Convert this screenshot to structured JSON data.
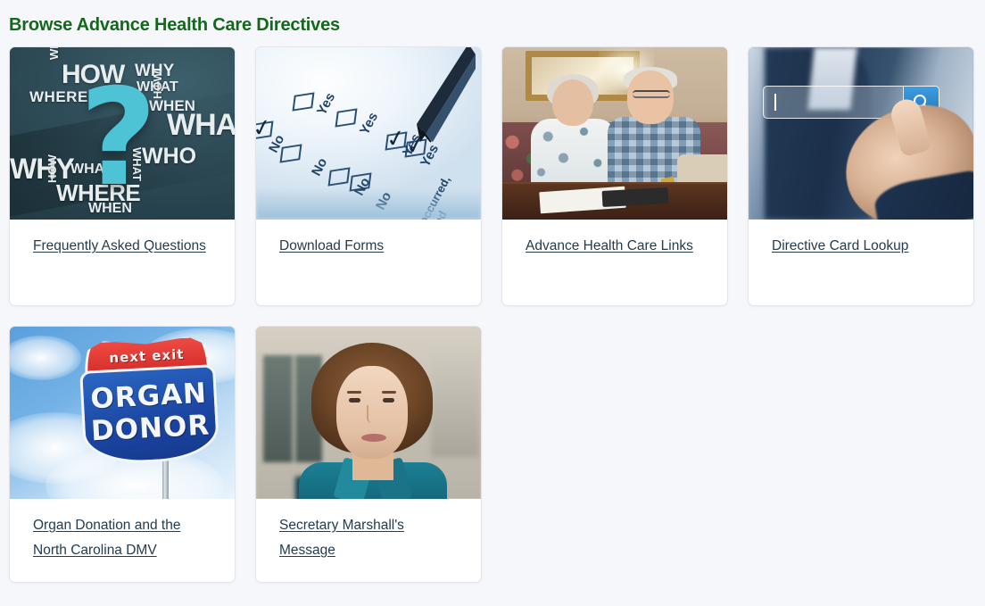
{
  "page": {
    "title": "Browse Advance Health Care Directives",
    "title_color": "#14681c",
    "background_color": "#f6f7fb",
    "link_color": "#243c4f",
    "card_background": "#ffffff",
    "card_border_color": "#e3e5ea"
  },
  "cards": [
    {
      "id": "faq",
      "link_label": "Frequently Asked Questions",
      "image_name": "question-mark-chalkboard-image",
      "image_alt": "Teal chalkboard covered with the words WHO, HOW, WHY, WHAT, WHERE, WHEN around a large cyan question mark",
      "image_words": [
        "WHO",
        "HOW",
        "WHY",
        "WHAT",
        "WHERE",
        "WHEN",
        "HOW",
        "WHAT",
        "WHO",
        "WHY",
        "WHAT",
        "WHERE",
        "HOW",
        "WHEN",
        "WHAT"
      ],
      "image_question_mark": "?"
    },
    {
      "id": "download-forms",
      "link_label": "Download Forms",
      "image_name": "checkbox-form-with-pen-image",
      "image_alt": "Close-up of a blue-tinted questionnaire with Yes and No checkboxes being ticked by a fountain pen",
      "image_options": [
        "Yes",
        "No",
        "Yes",
        "No",
        "Yes",
        "No",
        "Yes",
        "No"
      ],
      "image_caption_fragment": "occurred, and"
    },
    {
      "id": "advance-health-care-links",
      "link_label": "Advance Health Care Links",
      "image_name": "elderly-couple-signing-documents-image",
      "image_alt": "Smiling elderly couple seated on a sofa at a wooden table with paperwork in front of them"
    },
    {
      "id": "directive-card-lookup",
      "link_label": "Directive Card Lookup",
      "image_name": "search-bar-touch-image",
      "image_alt": "Man in a suit touching a virtual search bar with a blue magnifying glass button",
      "search_icon": "magnifier-icon"
    },
    {
      "id": "organ-donation-dmv",
      "link_label": "Organ Donation and the North Carolina DMV",
      "image_name": "organ-donor-road-sign-image",
      "image_alt": "Red and blue highway shield road sign against a blue cloudy sky",
      "sign_text": {
        "top": "next exit",
        "line1": "ORGAN",
        "line2": "DONOR"
      }
    },
    {
      "id": "secretary-marshalls-message",
      "link_label": "Secretary Marshall's Message",
      "image_name": "secretary-portrait-image",
      "image_alt": "Portrait of a woman with short brown hair wearing a teal jacket standing outside a stone building"
    }
  ]
}
